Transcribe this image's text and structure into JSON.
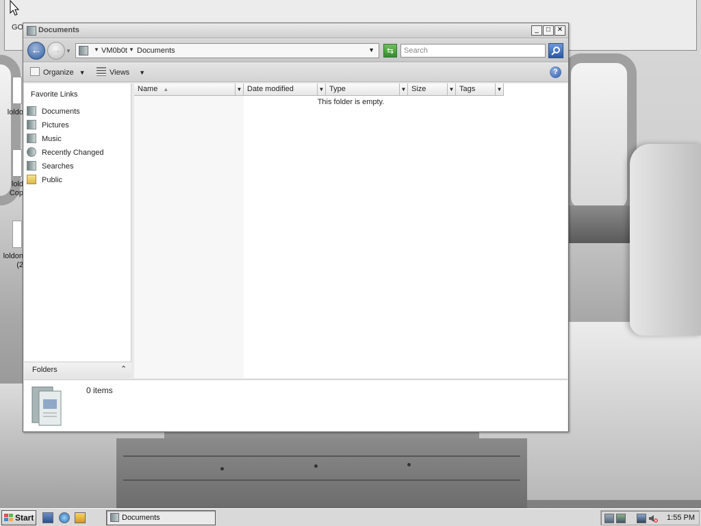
{
  "window": {
    "title": "Documents",
    "minimize_label": "_",
    "maximize_label": "□",
    "close_label": "✕"
  },
  "address": {
    "segments": [
      "VM0b0t",
      "Documents"
    ],
    "search_placeholder": "Search"
  },
  "toolbar": {
    "organize_label": "Organize",
    "views_label": "Views",
    "help_label": "?"
  },
  "nav_pane": {
    "title": "Favorite Links",
    "items": [
      {
        "label": "Documents",
        "icon": "documents-icon"
      },
      {
        "label": "Pictures",
        "icon": "pictures-icon"
      },
      {
        "label": "Music",
        "icon": "music-icon"
      },
      {
        "label": "Recently Changed",
        "icon": "recently-changed-icon"
      },
      {
        "label": "Searches",
        "icon": "searches-icon"
      },
      {
        "label": "Public",
        "icon": "folder-icon"
      }
    ],
    "folders_label": "Folders"
  },
  "file_list": {
    "columns": [
      "Name",
      "Date modified",
      "Type",
      "Size",
      "Tags"
    ],
    "empty_message": "This folder is empty."
  },
  "details": {
    "item_count": "0 items"
  },
  "background_app": {
    "text": "GO"
  },
  "desktop_icons": [
    "loldo",
    "lold\nCop",
    "loldon\n(2"
  ],
  "taskbar": {
    "start_label": "Start",
    "task_label": "Documents",
    "clock": "1:55 PM"
  }
}
